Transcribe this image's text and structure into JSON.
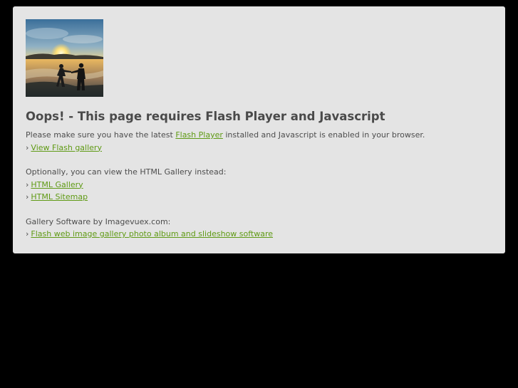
{
  "colors": {
    "page_background": "#000000",
    "panel_background": "#e4e4e4",
    "heading": "#4a4a4a",
    "text": "#4d4d4d",
    "link": "#5f9a14"
  },
  "thumbnail": {
    "icon": "beach-sunset-couple-photo"
  },
  "heading": "Oops! - This page requires Flash Player and Javascript",
  "requirement": {
    "before": "Please make sure you have the latest ",
    "link": "Flash Player",
    "after": " installed and Javascript is enabled in your browser."
  },
  "bullet": "›",
  "view_flash_link": "View Flash gallery",
  "optional_text": "Optionally, you can view the HTML Gallery instead:",
  "html_gallery_link": "HTML Gallery",
  "html_sitemap_link": "HTML Sitemap",
  "software_text": "Gallery Software by Imagevuex.com:",
  "software_link": "Flash web image gallery photo album and slideshow software"
}
